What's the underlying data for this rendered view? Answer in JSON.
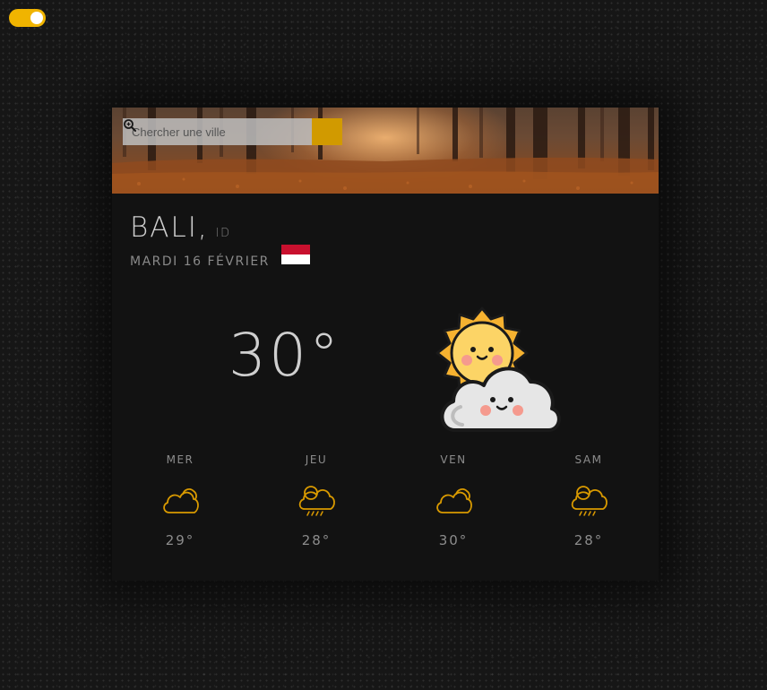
{
  "theme_toggle": {
    "state": "on",
    "accent": "#f0b400"
  },
  "search": {
    "placeholder": "Chercher une ville",
    "button_icon": "search-zoom-icon"
  },
  "location": {
    "city": "BALI,",
    "country": "ID",
    "date": "MARDI 16 FÉVRIER",
    "flag": "indonesia-flag"
  },
  "current": {
    "temperature": "30°",
    "icon": "sun-behind-cloud-icon"
  },
  "forecast": [
    {
      "day": "MER",
      "temp": "29°",
      "icon": "cloud-icon"
    },
    {
      "day": "JEU",
      "temp": "28°",
      "icon": "sun-cloud-rain-icon"
    },
    {
      "day": "VEN",
      "temp": "30°",
      "icon": "cloud-icon"
    },
    {
      "day": "SAM",
      "temp": "28°",
      "icon": "sun-cloud-rain-icon"
    }
  ],
  "colors": {
    "accent": "#d19a00",
    "card": "#121212",
    "text": "#cfcfcf",
    "muted": "#8c8c8c"
  }
}
